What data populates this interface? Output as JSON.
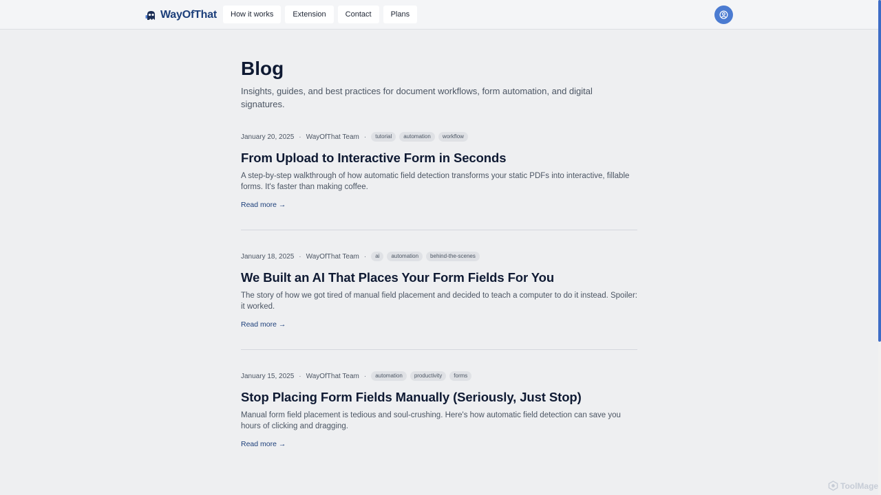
{
  "header": {
    "brand": "WayOfThat",
    "nav": [
      {
        "label": "How it works"
      },
      {
        "label": "Extension"
      },
      {
        "label": "Contact"
      },
      {
        "label": "Plans"
      }
    ],
    "avatar_icon": "user-circle-icon"
  },
  "page": {
    "title": "Blog",
    "subtitle": "Insights, guides, and best practices for document workflows, form automation, and digital signatures."
  },
  "posts": [
    {
      "date": "January 20, 2025",
      "author": "WayOfThat Team",
      "tags": [
        "tutorial",
        "automation",
        "workflow"
      ],
      "title": "From Upload to Interactive Form in Seconds",
      "excerpt": "A step-by-step walkthrough of how automatic field detection transforms your static PDFs into interactive, fillable forms. It's faster than making coffee.",
      "read_more": "Read more →"
    },
    {
      "date": "January 18, 2025",
      "author": "WayOfThat Team",
      "tags": [
        "ai",
        "automation",
        "behind-the-scenes"
      ],
      "title": "We Built an AI That Places Your Form Fields For You",
      "excerpt": "The story of how we got tired of manual field placement and decided to teach a computer to do it instead. Spoiler: it worked.",
      "read_more": "Read more →"
    },
    {
      "date": "January 15, 2025",
      "author": "WayOfThat Team",
      "tags": [
        "automation",
        "productivity",
        "forms"
      ],
      "title": "Stop Placing Form Fields Manually (Seriously, Just Stop)",
      "excerpt": "Manual form field placement is tedious and soul-crushing. Here's how automatic field detection can save you hours of clicking and dragging.",
      "read_more": "Read more →"
    }
  ],
  "watermark": "ToolMage",
  "colors": {
    "brand": "#1c3f7a",
    "accent": "#4b7bd1",
    "background": "#eeeff1"
  }
}
